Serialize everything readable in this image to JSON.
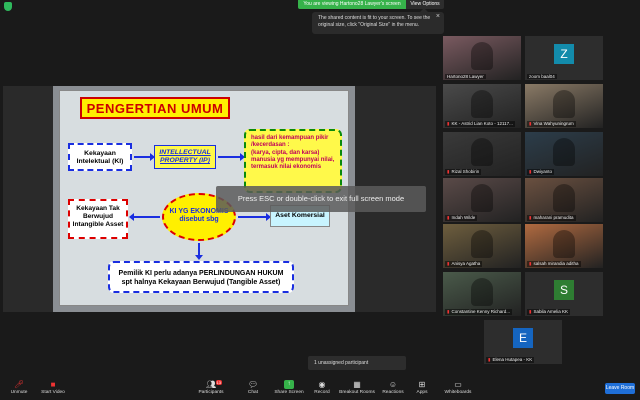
{
  "banner": {
    "viewing_text": "You are viewing Hartono28 Lawyer's screen",
    "view_options": "View Options"
  },
  "toast": {
    "text": "The shared content is fit to your screen. To see the original size, click \"Original Size\" in the menu."
  },
  "slide": {
    "title": "PENGERTIAN UMUM",
    "ki": "Kekayaan Intelektual (KI)",
    "ip": "INTELLECTUAL PROPERTY (IP)",
    "defn_line1": "hasil dari kemampuan pikir /kecerdasan :",
    "defn_line2": "(karya, cipta, dan karsa) manusia yg mempunyai nilai, termasuk nilai ekonomis",
    "intangible": "Kekayaan Tak Berwujud Intangible Asset",
    "ellipse": "KI YG EKONOMIS disebut sbg",
    "komersial": "Aset Komersial",
    "pemilik_line1": "Pemilik KI perlu adanya PERLINDUNGAN HUKUM",
    "pemilik_line2": "spt halnya Kekayaan Berwujud (Tangible Asset)"
  },
  "esc_overlay": "Press ESC or double-click to exit full screen mode",
  "participants": [
    {
      "name": "Hartono28 Lawyer",
      "muted": false,
      "kind": "video",
      "color": "#7a5a60"
    },
    {
      "name": "zoom baal04",
      "muted": false,
      "kind": "avatar",
      "letter": "Z",
      "color": "#138bab"
    },
    {
      "name": "KK - Astrid Lian Koto - 12117...",
      "muted": true,
      "kind": "video",
      "color": "#4a4a4a"
    },
    {
      "name": "Vina Wahyuningrum",
      "muted": true,
      "kind": "video",
      "color": "#8a7a66"
    },
    {
      "name": "Rizal Shobirin",
      "muted": true,
      "kind": "video",
      "color": "#3a3a3a"
    },
    {
      "name": "Dwiyanto",
      "muted": true,
      "kind": "video",
      "color": "#2c3d4a"
    },
    {
      "name": "Indah Wilde",
      "muted": true,
      "kind": "video",
      "color": "#5a4a48"
    },
    {
      "name": "maharani pramudita",
      "muted": true,
      "kind": "video",
      "color": "#6a5040"
    },
    {
      "name": "Anisya Agatha",
      "muted": true,
      "kind": "video",
      "color": "#6e5e3e"
    },
    {
      "name": "salsah mirandia aditha",
      "muted": true,
      "kind": "video",
      "color": "#b06a40"
    },
    {
      "name": "Constantine Kenny Richard...",
      "muted": true,
      "kind": "video",
      "color": "#4a5a4a"
    },
    {
      "name": "Sabila Amelia KK",
      "muted": true,
      "kind": "avatar",
      "letter": "S",
      "color": "#2e7d32"
    },
    {
      "name": "Elena Hutapea - KK",
      "muted": true,
      "kind": "avatar",
      "letter": "E",
      "color": "#1565c0"
    }
  ],
  "unassigned": "1 unassigned participant",
  "toolbar": {
    "unmute": "Unmute",
    "start_video": "Start Video",
    "participants": "Participants",
    "participants_count": "13",
    "chat": "Chat",
    "share_screen": "Share Screen",
    "record": "Record",
    "breakout": "Breakout Rooms",
    "reactions": "Reactions",
    "apps": "Apps",
    "whiteboards": "Whiteboards",
    "leave": "Leave Room"
  }
}
